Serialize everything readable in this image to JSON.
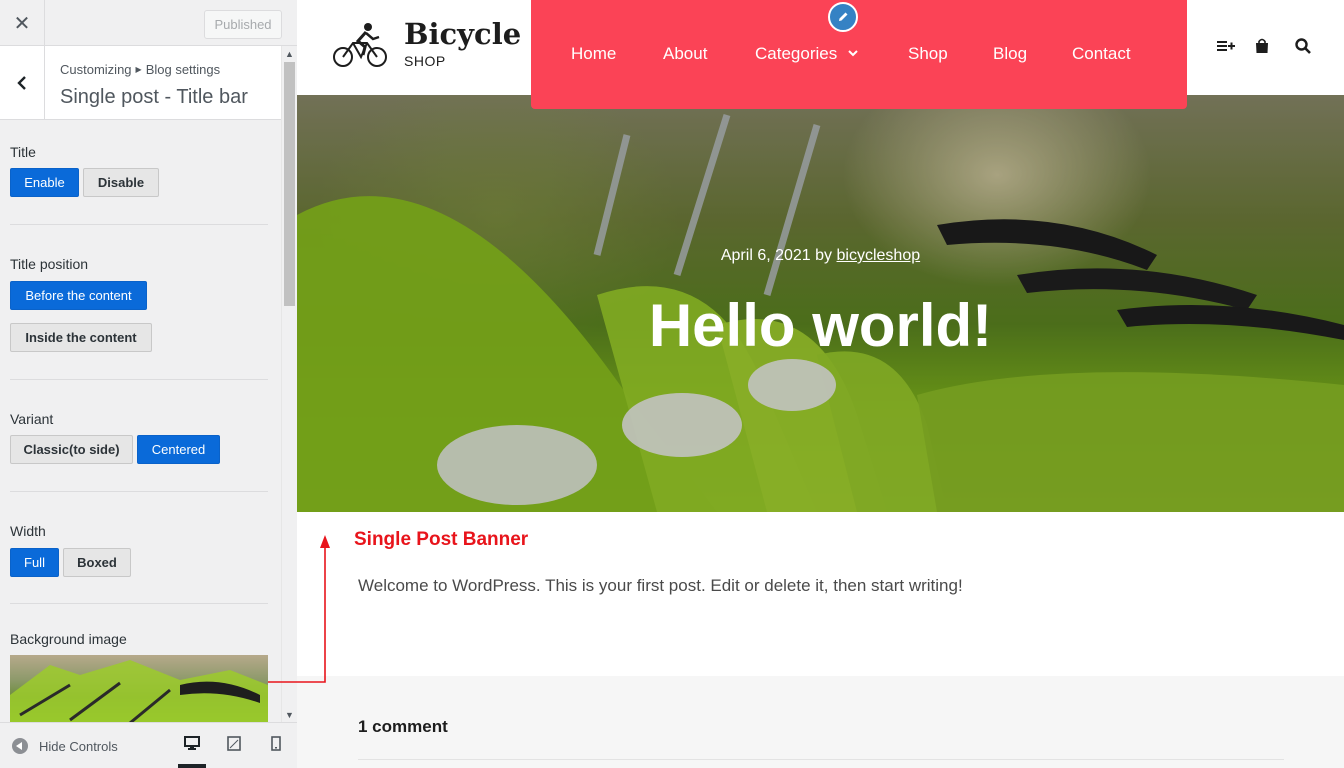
{
  "customizer": {
    "close_icon": "close-icon",
    "publish_label": "Published",
    "breadcrumb": [
      "Customizing",
      "Blog settings"
    ],
    "section_title": "Single post - Title bar",
    "controls": {
      "title": {
        "label": "Title",
        "options": [
          "Enable",
          "Disable"
        ],
        "selected": "Enable"
      },
      "title_position": {
        "label": "Title position",
        "options": [
          "Before the content",
          "Inside the content"
        ],
        "selected": "Before the content"
      },
      "variant": {
        "label": "Variant",
        "options": [
          "Classic(to side)",
          "Centered"
        ],
        "selected": "Centered"
      },
      "width": {
        "label": "Width",
        "options": [
          "Full",
          "Boxed"
        ],
        "selected": "Full"
      },
      "background_image": {
        "label": "Background image"
      }
    },
    "footer": {
      "hide_controls": "Hide Controls",
      "devices": [
        "desktop-icon",
        "tablet-icon",
        "mobile-icon"
      ],
      "active_device": "desktop"
    }
  },
  "site": {
    "logo": {
      "name": "Bicycle",
      "tagline": "SHOP"
    },
    "nav": [
      "Home",
      "About",
      "Categories",
      "Shop",
      "Blog",
      "Contact"
    ],
    "nav_color": "#fb4356",
    "header_icons": [
      "menu-plus-icon",
      "bag-icon",
      "search-icon"
    ],
    "post": {
      "date": "April 6, 2021",
      "by": "by",
      "author": "bicycleshop",
      "title": "Hello world!",
      "content": "Welcome to WordPress. This is your first post. Edit or delete it, then start writing!"
    },
    "comments_title": "1 comment"
  },
  "annotation": {
    "label": "Single Post Banner",
    "color": "#e8141b"
  }
}
